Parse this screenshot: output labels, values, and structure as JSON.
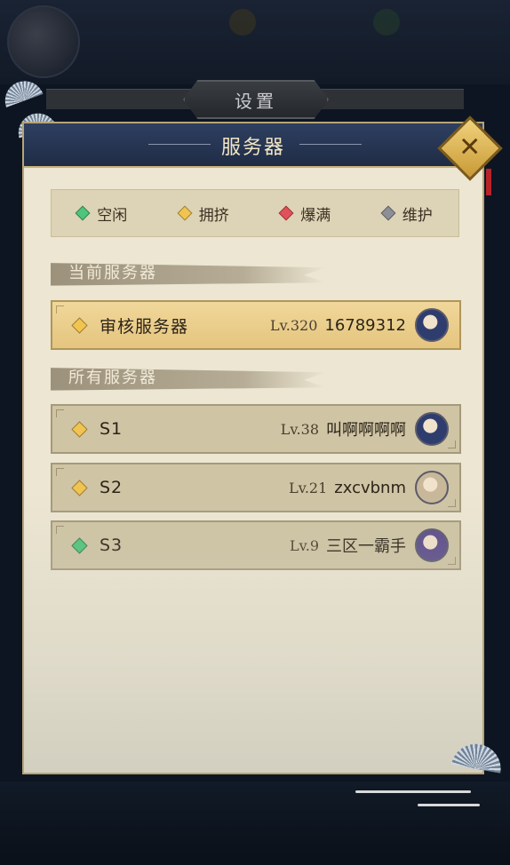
{
  "settings_tab": {
    "label": "设置"
  },
  "panel": {
    "title": "服务器"
  },
  "legend": [
    {
      "label": "空闲",
      "color": "#4fc47a"
    },
    {
      "label": "拥挤",
      "color": "#f1c451"
    },
    {
      "label": "爆满",
      "color": "#e2505a"
    },
    {
      "label": "维护",
      "color": "#8c8f96"
    }
  ],
  "current_section": {
    "label": "当前服务器"
  },
  "current_server": {
    "name": "审核服务器",
    "level": "Lv.320",
    "player": "16789312",
    "status_color": "#f1c451",
    "avatar_color": "#2e3d6e"
  },
  "all_section": {
    "label": "所有服务器"
  },
  "servers": [
    {
      "name": "S1",
      "level": "Lv.38",
      "player": "叫啊啊啊啊",
      "status_color": "#f1c451",
      "avatar_color": "#2e3d6e"
    },
    {
      "name": "S2",
      "level": "Lv.21",
      "player": "zxcvbnm",
      "status_color": "#f1c451",
      "avatar_color": "#c9b79a"
    },
    {
      "name": "S3",
      "level": "Lv.9",
      "player": "三区一霸手",
      "status_color": "#4fc47a",
      "avatar_color": "#5a4a8a"
    }
  ],
  "icons": {
    "close": "close-icon",
    "status": "diamond-icon",
    "avatar": "player-avatar"
  }
}
